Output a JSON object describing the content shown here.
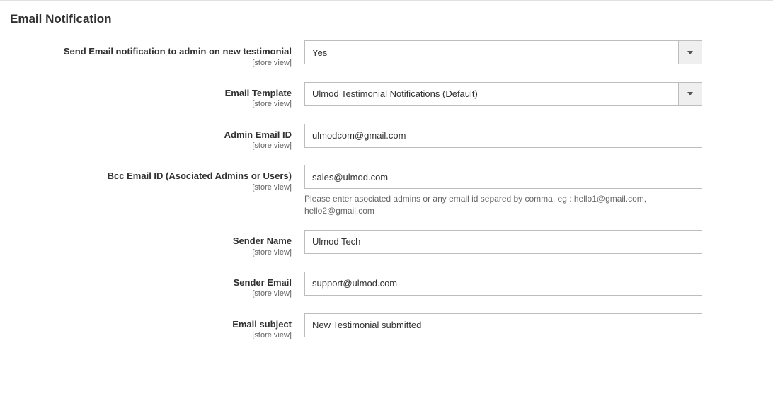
{
  "section_title": "Email Notification",
  "scope_label": "[store view]",
  "fields": {
    "send_email": {
      "label": "Send Email notification to admin on new testimonial",
      "value": "Yes"
    },
    "email_template": {
      "label": "Email Template",
      "value": "Ulmod Testimonial Notifications (Default)"
    },
    "admin_email_id": {
      "label": "Admin Email ID",
      "value": "ulmodcom@gmail.com"
    },
    "bcc_email": {
      "label": "Bcc Email ID (Asociated Admins or Users)",
      "value": "sales@ulmod.com",
      "help": "Please enter asociated admins or any email id separed by comma, eg : hello1@gmail.com, hello2@gmail.com"
    },
    "sender_name": {
      "label": "Sender Name",
      "value": "Ulmod Tech"
    },
    "sender_email": {
      "label": "Sender Email",
      "value": "support@ulmod.com"
    },
    "email_subject": {
      "label": "Email subject",
      "value": "New Testimonial submitted"
    }
  }
}
